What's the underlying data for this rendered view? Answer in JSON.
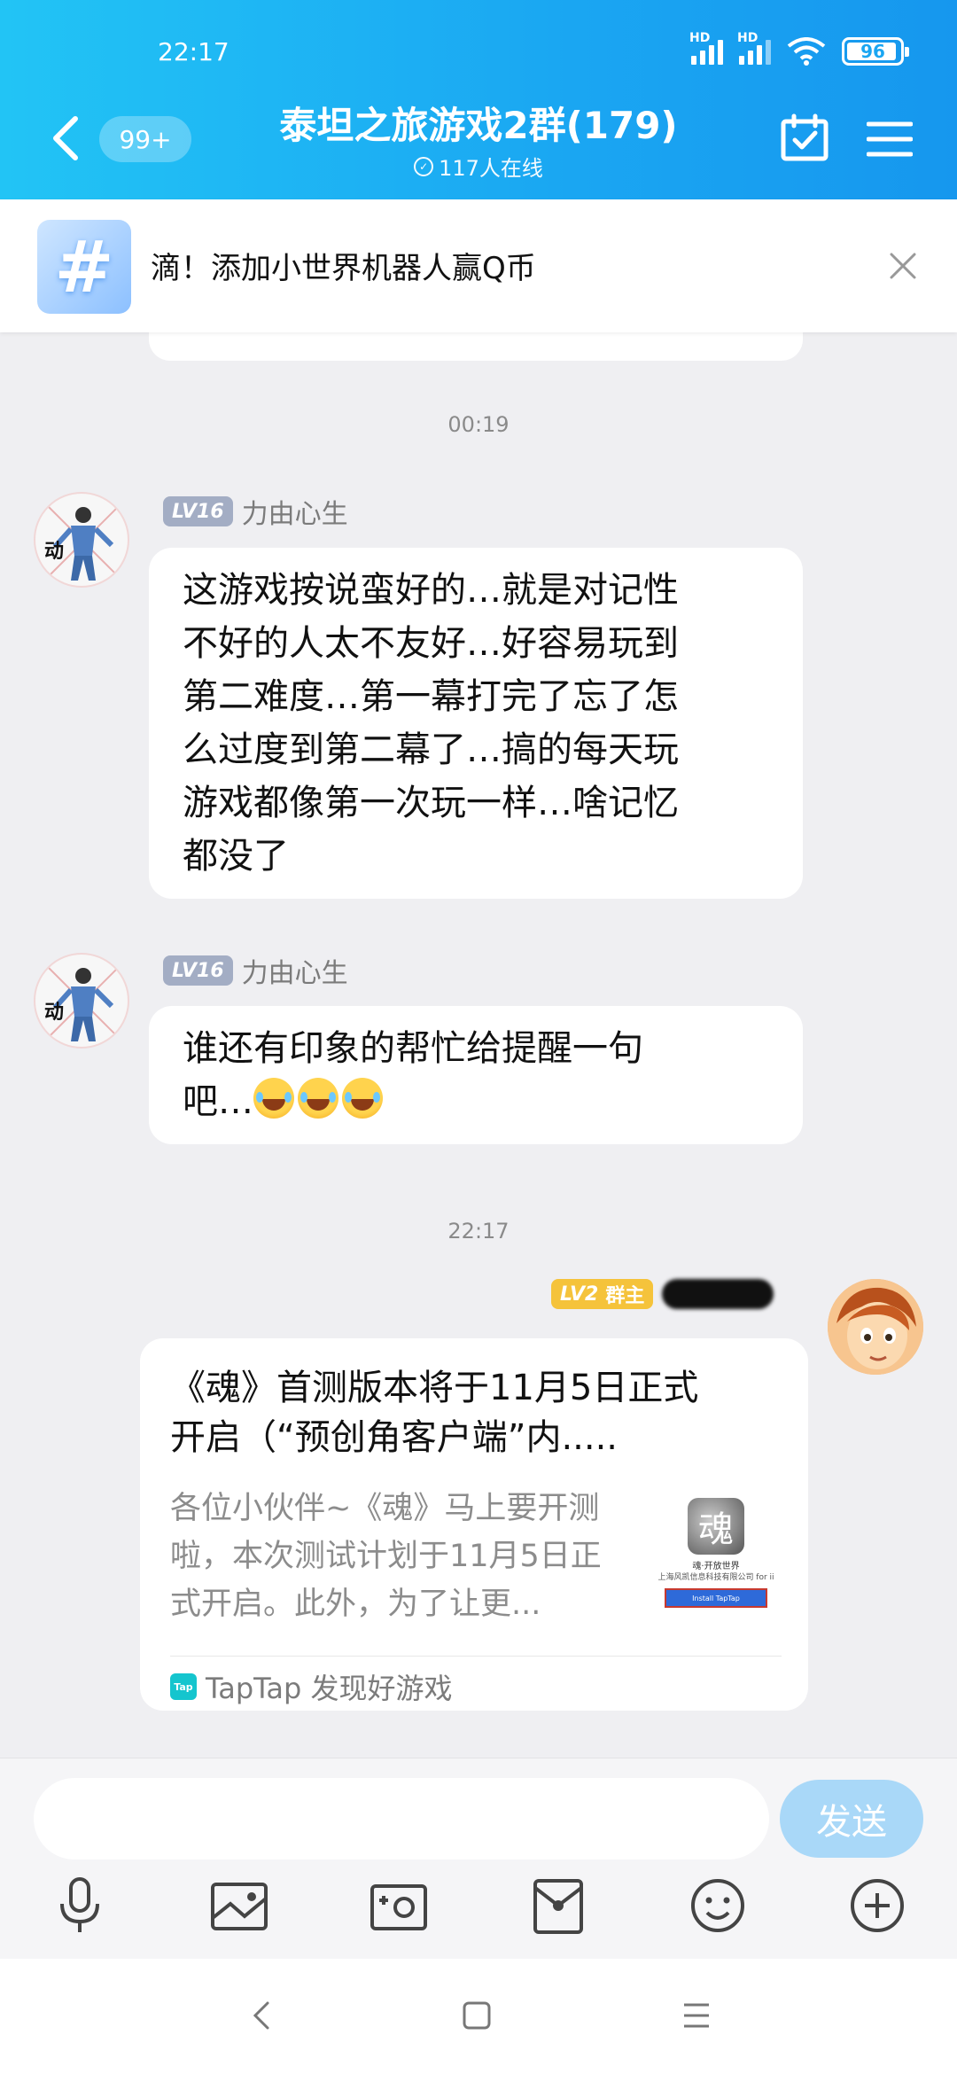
{
  "status": {
    "time": "22:17",
    "battery": "96",
    "hd1": "HD",
    "hd2": "HD"
  },
  "header": {
    "unread_badge": "99+",
    "title": "泰坦之旅游戏2群(179)",
    "online": "117人在线"
  },
  "banner": {
    "text": "滴！添加小世界机器人赢Q币",
    "logo_char": "#"
  },
  "messages": [
    {
      "time": "00:19"
    },
    {
      "level": "LV16",
      "name": "力由心生",
      "lines": [
        "这游戏按说蛮好的…就是对记性",
        "不好的人太不友好…好容易玩到",
        "第二难度…第一幕打完了忘了怎",
        "么过度到第二幕了…搞的每天玩",
        "游戏都像第一次玩一样…啥记忆",
        "都没了"
      ]
    },
    {
      "level": "LV16",
      "name": "力由心生",
      "lines": [
        "谁还有印象的帮忙给提醒一句",
        "吧…"
      ]
    },
    {
      "time": "22:17"
    },
    {
      "level": "LV2",
      "role": "群主",
      "card": {
        "title_lines": [
          "《魂》首测版本将于11月5日正式",
          "开启（“预创角客户端”内....."
        ],
        "desc_lines": [
          "各位小伙伴~《魂》马上要开测",
          "啦，本次测试计划于11月5日正",
          "式开启。此外，为了让更..."
        ],
        "thumb_char": "魂",
        "thumb_line1": "魂·开放世界",
        "thumb_line2": "上海风凯信息科技有限公司 for ii",
        "thumb_button": "Install TapTap",
        "source_icon": "Tap",
        "source": "TapTap 发现好游戏"
      }
    }
  ],
  "input": {
    "placeholder": "",
    "send_label": "发送"
  },
  "icons": [
    "back-icon",
    "calendar-check-icon",
    "menu-icon",
    "close-icon",
    "microphone-icon",
    "image-icon",
    "camera-icon",
    "red-packet-icon",
    "emoji-icon",
    "plus-icon",
    "nav-back-icon",
    "nav-home-icon",
    "nav-menu-icon"
  ]
}
